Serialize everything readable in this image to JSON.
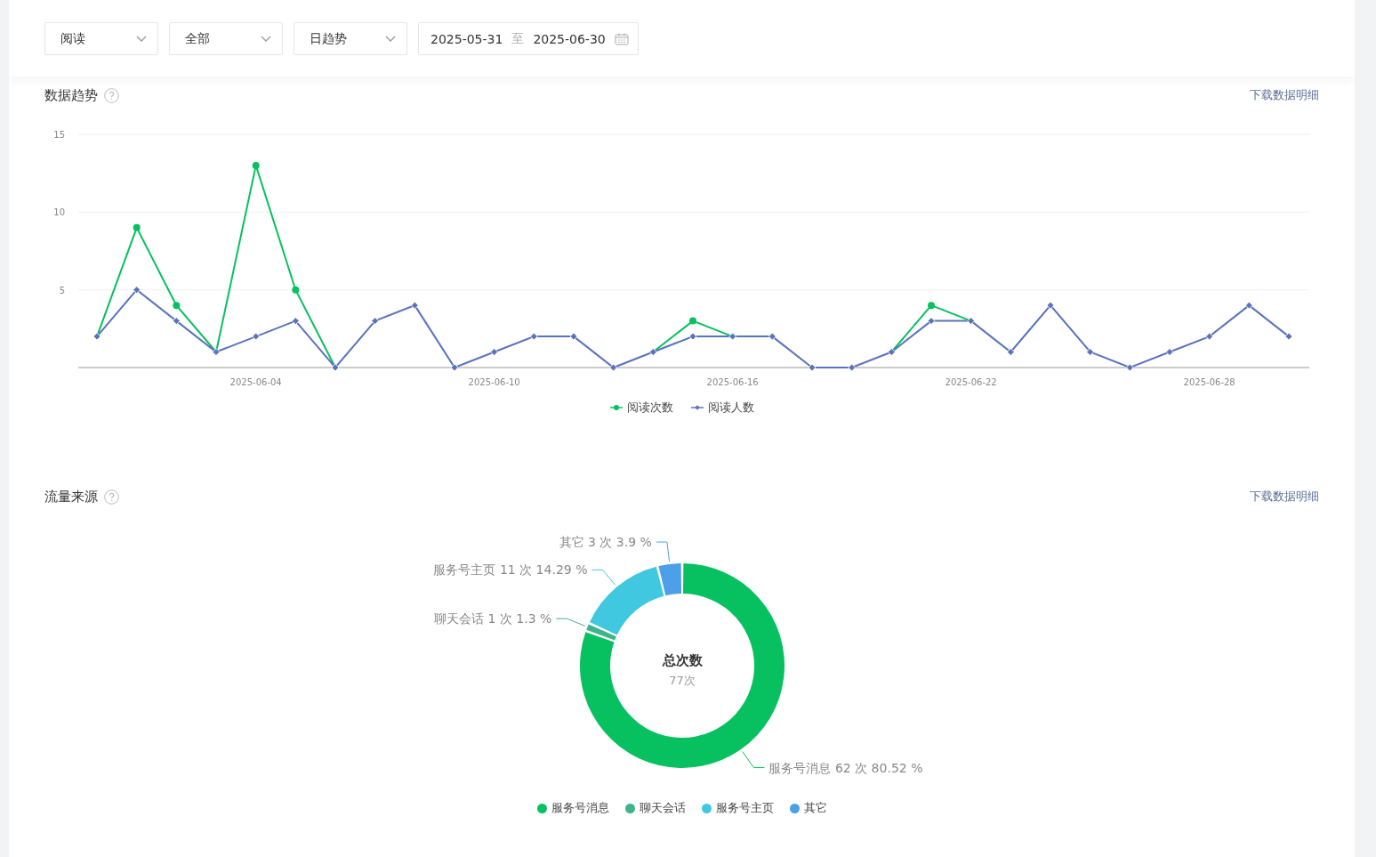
{
  "filters": [
    {
      "value": "阅读"
    },
    {
      "value": "全部"
    },
    {
      "value": "日趋势"
    }
  ],
  "date_range": {
    "start": "2025-05-31",
    "separator": "至",
    "end": "2025-06-30"
  },
  "trend": {
    "title": "数据趋势",
    "download": "下载数据明细",
    "chart_data": {
      "type": "line",
      "categories": [
        null,
        null,
        null,
        null,
        "2025-06-04",
        null,
        null,
        null,
        null,
        null,
        "2025-06-10",
        null,
        null,
        null,
        null,
        null,
        "2025-06-16",
        null,
        null,
        null,
        null,
        null,
        "2025-06-22",
        null,
        null,
        null,
        null,
        null,
        "2025-06-28",
        null,
        null
      ],
      "ylim": [
        0,
        15
      ],
      "yticks": [
        5,
        10,
        15
      ],
      "legend": true,
      "series": [
        {
          "name": "阅读次数",
          "color": "#07c160",
          "values": [
            2,
            9,
            4,
            1,
            13,
            5,
            0,
            null,
            null,
            null,
            null,
            null,
            null,
            null,
            1,
            3,
            2,
            null,
            null,
            null,
            1,
            4,
            3,
            null,
            null,
            null,
            null,
            null,
            null,
            null,
            null
          ]
        },
        {
          "name": "阅读人数",
          "color": "#5b73bd",
          "marker": "diamond",
          "values": [
            2,
            5,
            3,
            1,
            2,
            3,
            0,
            3,
            4,
            0,
            1,
            2,
            2,
            0,
            1,
            2,
            2,
            2,
            0,
            0,
            1,
            3,
            3,
            1,
            4,
            1,
            0,
            1,
            2,
            4,
            2
          ]
        }
      ]
    }
  },
  "traffic": {
    "title": "流量来源",
    "download": "下载数据明细",
    "center_title": "总次数",
    "center_value": "77次",
    "chart_data": {
      "type": "donut",
      "categories": [
        "服务号消息",
        "聊天会话",
        "服务号主页",
        "其它"
      ],
      "legend": true,
      "series": [
        {
          "values": [
            80.52,
            1.3,
            14.29,
            3.9
          ]
        }
      ],
      "colors": [
        "#07c160",
        "#3eb489",
        "#40c8e0",
        "#4c9fe8"
      ],
      "value_labels": [
        "服务号消息 62 次 80.52 %",
        "聊天会话 1 次 1.3 %",
        "服务号主页 11 次 14.29 %",
        "其它 3 次 3.9 %"
      ]
    }
  }
}
